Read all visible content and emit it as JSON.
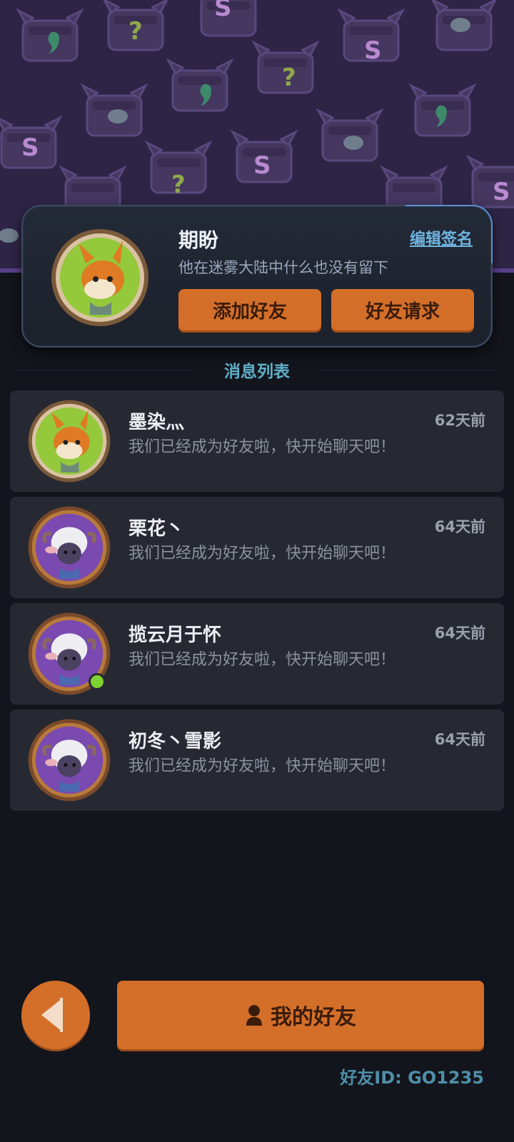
{
  "profile": {
    "name": "期盼",
    "edit_sign_label": "编辑签名",
    "signature": "他在迷雾大陆中什么也没有留下",
    "add_friend_label": "添加好友",
    "friend_request_label": "好友请求",
    "avatar_icon": "fox-avatar-icon"
  },
  "messages": {
    "title": "消息列表",
    "items": [
      {
        "name": "墨染灬",
        "time": "62天前",
        "text": "我们已经成为好友啦，快开始聊天吧！",
        "avatar_icon": "fox-avatar-icon",
        "online": false
      },
      {
        "name": "栗花丶",
        "time": "64天前",
        "text": "我们已经成为好友啦，快开始聊天吧！",
        "avatar_icon": "sheep-avatar-icon",
        "online": false
      },
      {
        "name": "揽云月于怀",
        "time": "64天前",
        "text": "我们已经成为好友啦，快开始聊天吧！",
        "avatar_icon": "sheep-avatar-icon",
        "online": true
      },
      {
        "name": "初冬丶雪影",
        "time": "64天前",
        "text": "我们已经成为好友啦，快开始聊天吧！",
        "avatar_icon": "sheep-avatar-icon",
        "online": false
      }
    ]
  },
  "bottom": {
    "my_friends_label": "我的好友",
    "friend_id_text": "好友ID: GO1235"
  },
  "colors": {
    "accent_orange": "#d46f2a",
    "background": "#13151c",
    "banner_purple": "#2e2546",
    "online_green": "#7fd330",
    "link_blue": "#6fb4e0"
  }
}
